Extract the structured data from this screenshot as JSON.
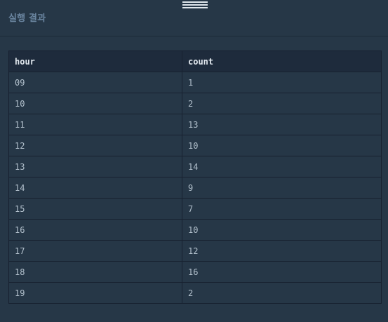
{
  "panel": {
    "title": "실행 결과"
  },
  "table": {
    "columns": [
      "hour",
      "count"
    ],
    "rows": [
      [
        "09",
        "1"
      ],
      [
        "10",
        "2"
      ],
      [
        "11",
        "13"
      ],
      [
        "12",
        "10"
      ],
      [
        "13",
        "14"
      ],
      [
        "14",
        "9"
      ],
      [
        "15",
        "7"
      ],
      [
        "16",
        "10"
      ],
      [
        "17",
        "12"
      ],
      [
        "18",
        "16"
      ],
      [
        "19",
        "2"
      ]
    ]
  },
  "icons": {
    "drag_handle": "drag-handle-icon"
  },
  "colors": {
    "background": "#263747",
    "header_bg": "#1e2b3c",
    "title": "#6a85a0",
    "text": "#b2c0cc"
  }
}
